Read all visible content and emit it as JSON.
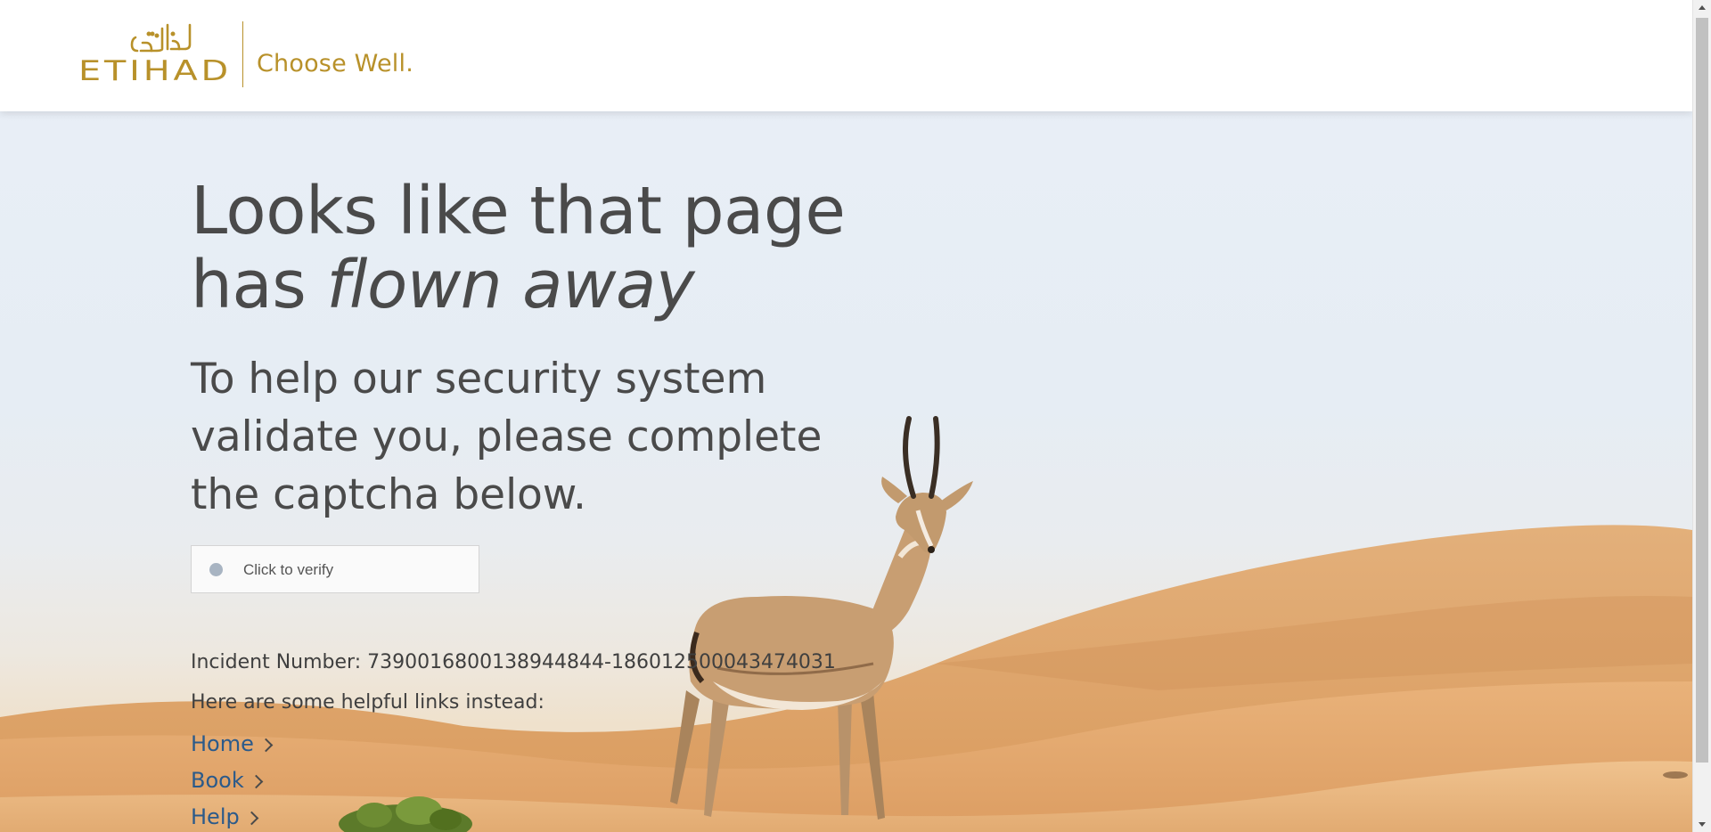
{
  "header": {
    "brand_arabic": "الاتحاد",
    "brand_latin": "ETIHAD",
    "tagline": "Choose Well."
  },
  "main": {
    "headline_line1": "Looks like that page",
    "headline_line2_prefix": "has ",
    "headline_line2_emphasis": "flown away",
    "subheading": "To help our security system validate you, please complete the captcha below.",
    "captcha_label": "Click to verify",
    "incident_text": "Incident Number: 7390016800138944844-186012500043474031",
    "helpful_links_intro": "Here are some helpful links instead:",
    "links": [
      {
        "label": "Home"
      },
      {
        "label": "Book"
      },
      {
        "label": "Help"
      }
    ]
  },
  "colors": {
    "brand_gold": "#b8912a",
    "text_dark": "#4a4a4a",
    "link_blue": "#2b5a8a"
  },
  "icons": {
    "captcha_status": "circle-indicator-icon",
    "link_chevron": "chevron-right-icon"
  }
}
